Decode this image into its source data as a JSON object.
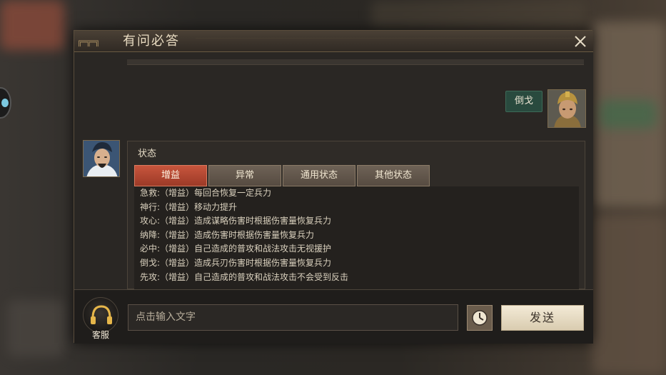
{
  "window": {
    "title": "有问必答"
  },
  "chat": {
    "user_message": "倒戈",
    "answer": {
      "title": "状态",
      "tabs": [
        {
          "label": "增益",
          "active": true
        },
        {
          "label": "异常",
          "active": false
        },
        {
          "label": "通用状态",
          "active": false
        },
        {
          "label": "其他状态",
          "active": false
        }
      ],
      "items": [
        "急救:（增益）每回合恢复一定兵力",
        "神行:（增益）移动力提升",
        "攻心:（增益）造成谋略伤害时根据伤害量恢复兵力",
        "纳降:（增益）造成伤害时根据伤害量恢复兵力",
        "必中:（增益）自己造成的普攻和战法攻击无视援护",
        "倒戈:（增益）造成兵刃伤害时根据伤害量恢复兵力",
        "先攻:（增益）自己造成的普攻和战法攻击不会受到反击"
      ]
    }
  },
  "input_bar": {
    "support_label": "客服",
    "input_placeholder": "点击输入文字",
    "send_label": "发送"
  },
  "colors": {
    "active_tab": "#b8462f",
    "inactive_tab": "#5f5449",
    "user_bubble": "#294a3e",
    "send_button": "#e8dcc2"
  },
  "icons": {
    "close": "close-icon",
    "history": "clock-icon",
    "support": "headset-icon"
  }
}
